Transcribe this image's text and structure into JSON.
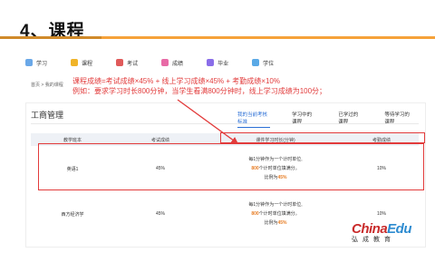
{
  "slide": {
    "title": "4、课程"
  },
  "nav": [
    {
      "label": "学习",
      "color": "#6aa8e8"
    },
    {
      "label": "课程",
      "color": "#f0b429"
    },
    {
      "label": "考试",
      "color": "#e05a5a"
    },
    {
      "label": "成绩",
      "color": "#e86aa6"
    },
    {
      "label": "毕业",
      "color": "#8a6de9"
    },
    {
      "label": "学位",
      "color": "#5aa9e6"
    }
  ],
  "breadcrumb": "首页 > 我的课程",
  "annotation": {
    "line1": "课程成绩=考试成绩×45% + 线上学习成绩×45% + 考勤成绩×10%",
    "line2": "例如：要求学习时长800分钟，当学生看满800分钟时，线上学习成绩为100分；"
  },
  "management": {
    "title": "工商管理",
    "tabs": [
      "我的当前考核标准",
      "学习中的课程",
      "已学过的课程",
      "等待学习的课程"
    ],
    "active_tab": 0
  },
  "table": {
    "headers": [
      "教学班本",
      "考试成绩",
      "课件学习时长(分钟)",
      "考勤成绩"
    ],
    "rows": [
      {
        "name": "英语1",
        "exam": "45%",
        "line1": "每1分钟作为一个计时单位,",
        "line2_num": "800",
        "line2_text": "个计时单位填满分。",
        "line3_text": "比例为",
        "line3_num": "45%",
        "attendance": "10%"
      },
      {
        "name": "西方经济学",
        "exam": "45%",
        "line1": "每1分钟作为一个计时单位,",
        "line2_num": "800",
        "line2_text": "个计时单位填满分。",
        "line3_text": "比例为",
        "line3_num": "45%",
        "attendance": "10%"
      }
    ]
  },
  "logo": {
    "main1": "China",
    "main2": "Edu",
    "cn": "弘成教育"
  }
}
